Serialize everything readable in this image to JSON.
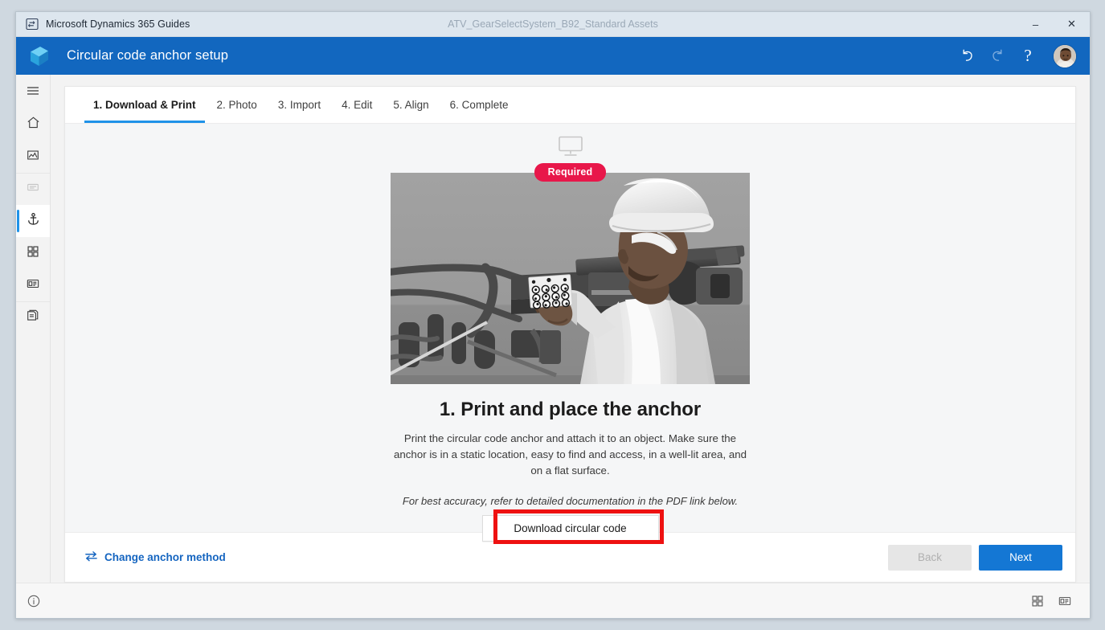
{
  "titlebar": {
    "app_name": "Microsoft Dynamics 365 Guides",
    "app_icon": "guides-app-icon",
    "document_name": "ATV_GearSelectSystem_B92_Standard Assets",
    "minimize_label": "–",
    "close_label": "✕"
  },
  "appbar": {
    "logo_icon": "dynamics-guides-logo",
    "title": "Circular code anchor setup",
    "undo_icon": "undo-icon",
    "redo_icon": "redo-icon",
    "help_label": "?",
    "avatar_icon": "user-avatar",
    "background_color": "#1267bf"
  },
  "sidebar": {
    "items": [
      {
        "id": "menu",
        "icon": "hamburger-menu-icon",
        "state": "normal"
      },
      {
        "id": "home",
        "icon": "home-icon",
        "state": "normal"
      },
      {
        "id": "media",
        "icon": "image-icon",
        "state": "normal"
      },
      {
        "id": "steps",
        "icon": "text-document-icon",
        "state": "disabled"
      },
      {
        "id": "anchor",
        "icon": "anchor-icon",
        "state": "active"
      },
      {
        "id": "parts",
        "icon": "grid-icon",
        "state": "normal"
      },
      {
        "id": "card",
        "icon": "card-layout-icon",
        "state": "normal"
      },
      {
        "id": "assets",
        "icon": "copy-stack-icon",
        "state": "normal"
      }
    ],
    "bottom_icon": "info-circle-icon"
  },
  "tabs": [
    {
      "label": "1. Download & Print",
      "active": true
    },
    {
      "label": "2. Photo",
      "active": false
    },
    {
      "label": "3. Import",
      "active": false
    },
    {
      "label": "4. Edit",
      "active": false
    },
    {
      "label": "5. Align",
      "active": false
    },
    {
      "label": "6. Complete",
      "active": false
    }
  ],
  "stage": {
    "device_icon": "desktop-monitor-icon",
    "required_badge": "Required",
    "required_badge_color": "#e8174a",
    "hero_image_alt": "Worker in hard hat holding a printed circular code anchor card near vehicle chassis",
    "headline": "1. Print and place the anchor",
    "body": "Print the circular code anchor and attach it to an object. Make sure the anchor is in a static location, easy to find and access, in a well-lit area, and on a flat surface.",
    "note": "For best accuracy, refer to detailed documentation in the PDF link below.",
    "download_button": "Download circular code",
    "annotation_color": "#ee1111"
  },
  "footer": {
    "change_method_icon": "swap-arrows-icon",
    "change_method_label": "Change anchor method",
    "back_label": "Back",
    "back_disabled": true,
    "next_label": "Next",
    "next_color": "#1477d4"
  },
  "statusbar": {
    "grid_view_icon": "grid-view-icon",
    "panel_view_icon": "panel-view-icon"
  }
}
